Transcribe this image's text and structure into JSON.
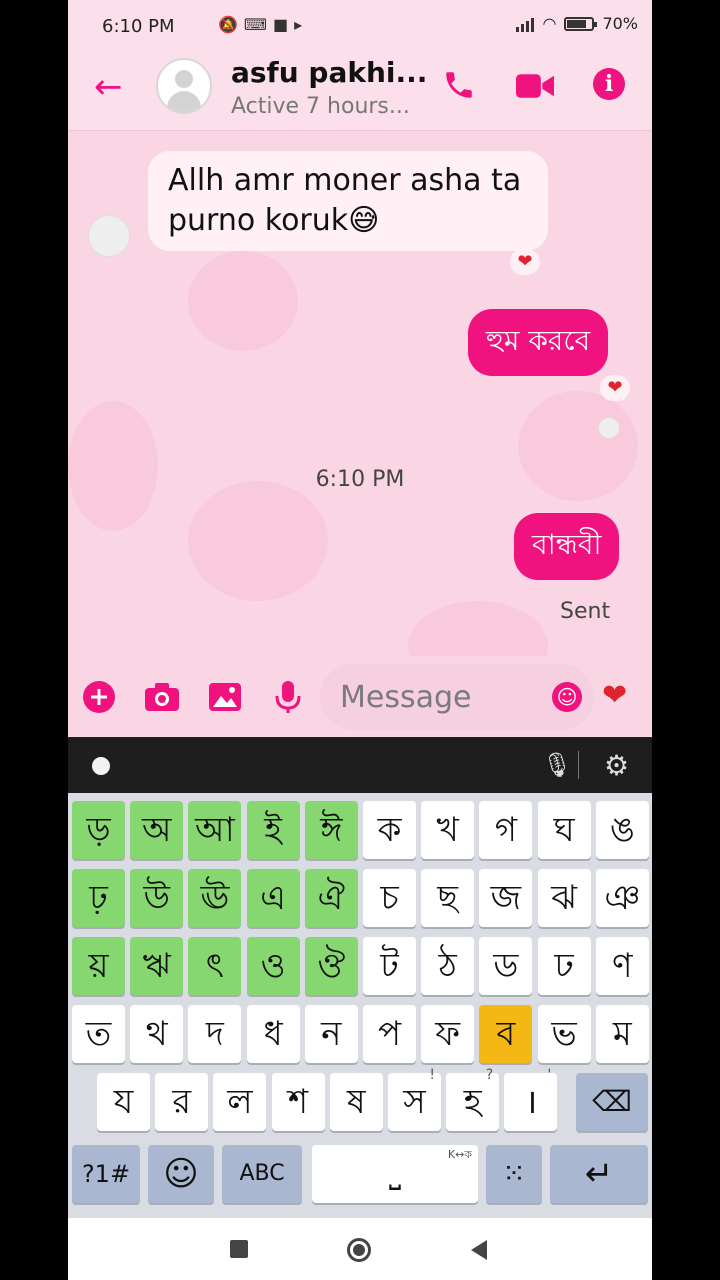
{
  "status_bar": {
    "time": "6:10 PM",
    "battery": "70%",
    "icons": [
      "mute-icon",
      "keyboard-icon",
      "video-icon",
      "play-icon"
    ]
  },
  "header": {
    "contact_name": "asfu pakhi...",
    "contact_status": "Active 7 hours..."
  },
  "messages": [
    {
      "direction": "incoming",
      "text": "Allh amr moner asha ta purno koruk😅",
      "reaction": "❤"
    },
    {
      "direction": "outgoing",
      "text": "হুম করবে",
      "reaction": "❤"
    },
    {
      "direction": "outgoing",
      "text": "বান্ধবী",
      "status": "Sent"
    }
  ],
  "timestamp": "6:10 PM",
  "composer": {
    "placeholder": "Message",
    "like_emoji": "❤"
  },
  "keyboard": {
    "rows": [
      [
        "ড়",
        "অ",
        "আ",
        "ই",
        "ঈ",
        "ক",
        "খ",
        "গ",
        "ঘ",
        "ঙ"
      ],
      [
        "ঢ়",
        "উ",
        "ঊ",
        "এ",
        "ঐ",
        "চ",
        "ছ",
        "জ",
        "ঝ",
        "ঞ"
      ],
      [
        "য়",
        "ঋ",
        "ৎ",
        "ও",
        "ঔ",
        "ট",
        "ঠ",
        "ড",
        "ঢ",
        "ণ"
      ],
      [
        "ত",
        "থ",
        "দ",
        "ধ",
        "ন",
        "প",
        "ফ",
        "ব",
        "ভ",
        "ম"
      ],
      [
        "য",
        "র",
        "ল",
        "শ",
        "ষ",
        "স",
        "হ",
        "।"
      ]
    ],
    "hints": {
      "s": "!",
      "h": "?",
      "danda": "'",
      "space": "K↔ক"
    },
    "symbols_key": "?1#",
    "abc_key": "ABC",
    "space_glyph": "⎵",
    "enter_glyph": "↵",
    "backspace_glyph": "⌫"
  },
  "colors": {
    "accent": "#f0127e",
    "vowel_key": "#86d76f",
    "highlight_key": "#f5b714",
    "chat_bg": "#fad6e5"
  }
}
